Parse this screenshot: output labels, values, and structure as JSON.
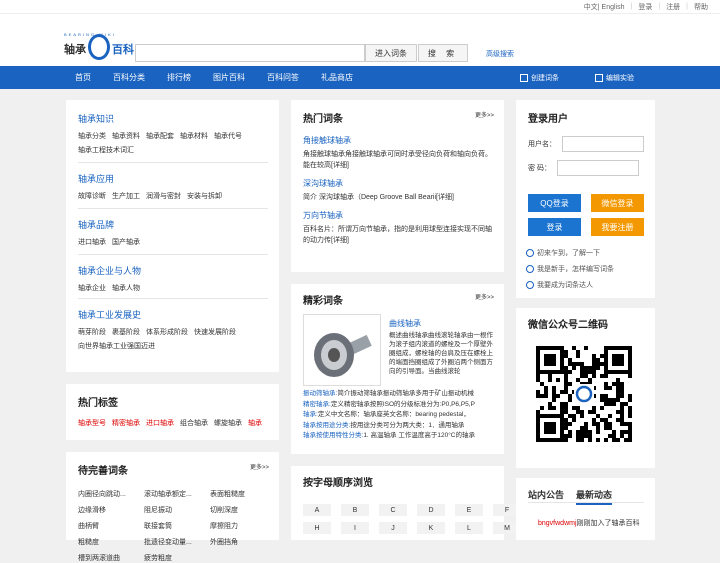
{
  "topbar": {
    "lang": "中文| English",
    "login": "登录",
    "register": "注册",
    "help": "帮助"
  },
  "logo": {
    "left": "轴承",
    "right": "百科",
    "sub": "BEARING WIKI"
  },
  "search": {
    "placeholder": "",
    "enter": "进入词条",
    "search": "搜 索",
    "advanced": "高级搜索"
  },
  "nav": {
    "items": [
      "首页",
      "百科分类",
      "排行榜",
      "图片百科",
      "百科问答",
      "礼品商店"
    ],
    "create": "创建词条",
    "lab": "编辑实验"
  },
  "knowledge": [
    {
      "title": "轴承知识",
      "links": [
        "轴承分类",
        "轴承资料",
        "轴承配套",
        "轴承材料",
        "轴承代号",
        "轴承工程技术词汇"
      ]
    },
    {
      "title": "轴承应用",
      "links": [
        "故障诊断",
        "生产加工",
        "润滑与密封",
        "安装与拆卸"
      ]
    },
    {
      "title": "轴承品牌",
      "links": [
        "进口轴承",
        "国产轴承"
      ]
    },
    {
      "title": "轴承企业与人物",
      "links": [
        "轴承企业",
        "轴承人物"
      ]
    },
    {
      "title": "轴承工业发展史",
      "links": [
        "萌芽阶段",
        "裹基阶段",
        "体系形成阶段",
        "快速发展阶段",
        "向世界轴承工业强国迈进"
      ]
    }
  ],
  "hot_tags": {
    "title": "热门标签",
    "tags": [
      {
        "t": "轴承型号",
        "red": true
      },
      {
        "t": "精密轴承",
        "red": true
      },
      {
        "t": "进口轴承",
        "red": true
      },
      {
        "t": "组合轴承",
        "red": false
      },
      {
        "t": "螺旋轴承",
        "red": false
      },
      {
        "t": "轴承",
        "red": true
      }
    ]
  },
  "pending": {
    "title": "待完善词条",
    "more": "更多>>",
    "items": [
      "内圈径向跳动...",
      "滚动轴承额定...",
      "表面粗糙度",
      "边缘滑移",
      "阻尼振动",
      "切削深度",
      "曲柄臂",
      "联接套筒",
      "摩擦阻力",
      "粗糙度",
      "批遗径变动量...",
      "外圈挡角",
      "槽到两滚道曲",
      "疲劳粗度"
    ]
  },
  "hot_entries": {
    "title": "热门词条",
    "more": "更多>>",
    "items": [
      {
        "title": "角接触球轴承",
        "desc": "角接触球轴承角接触球轴承可同时承受径向负荷和轴向负荷。能在较高[详细]"
      },
      {
        "title": "深沟球轴承",
        "desc": "简介 深沟球轴承（Deep Groove Ball Bearii[详细]"
      },
      {
        "title": "万向节轴承",
        "desc": "百科名片：所谓万向节轴承，指的是利用球型连接实现不同轴的动力传[详细]"
      }
    ]
  },
  "featured": {
    "title": "精彩词条",
    "more": "更多>>",
    "name": "曲线轴承",
    "desc": "概述曲线轴承曲线滚轮轴承由一根作为滚子组内滚道的螺栓及一个厚壁外圈组成，螺栓轴的台肩及压在螺栓上的端面挡圈组成了外圈沿两个侧面方向的引导面。当曲线滚轮",
    "lines": [
      {
        "k": "振动筛轴承:",
        "v": "简介振动筛轴承振动筛轴承多用于矿山振动机械"
      },
      {
        "k": "精密轴承:",
        "v": "定义精密轴承按照ISO的分级标准分为:P0,P6,P5,P"
      },
      {
        "k": "轴承:",
        "v": "定义中文名称：轴承座英文名称：bearing pedestal，"
      },
      {
        "k": "轴承按用途分类:",
        "v": "按用途分类可分为两大类：1．通用轴承"
      },
      {
        "k": "轴承按使用特性分类:",
        "v": "1. 高温轴承 工作温度高于120°C的轴承"
      }
    ]
  },
  "alpha": {
    "title": "按字母顺序浏览",
    "letters": [
      "A",
      "B",
      "C",
      "D",
      "E",
      "F",
      "H",
      "I",
      "J",
      "K",
      "L",
      "M"
    ]
  },
  "login": {
    "title": "登录用户",
    "user": "用户名：",
    "pass": "密  码：",
    "qq": "QQ登录",
    "wechat": "微信登录",
    "login": "登录",
    "reg": "我要注册",
    "q1": "初来乍到，了解一下",
    "q2": "我是新手，怎样编写词条",
    "q3": "我要成为词条达人"
  },
  "qr": {
    "title": "微信公众号二维码"
  },
  "news": {
    "tab1": "站内公告",
    "tab2": "最新动态",
    "n1_user": "bngvfwdwmj",
    "n1_text": "刚刚加入了轴承百科"
  }
}
